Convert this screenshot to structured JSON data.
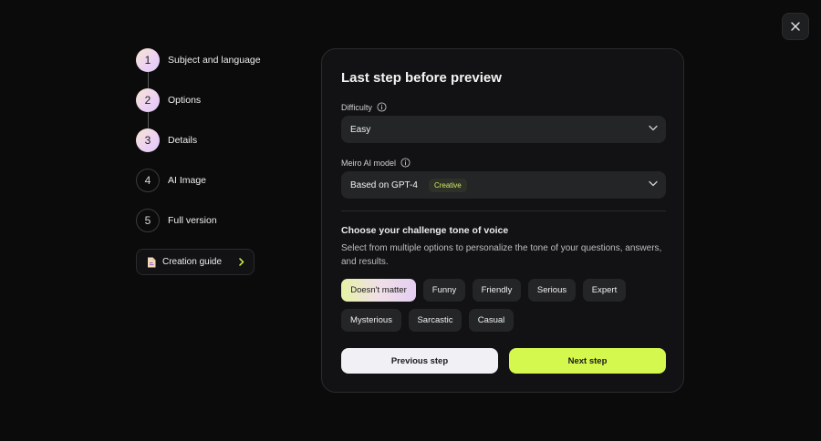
{
  "colors": {
    "background": "#0b0b0b",
    "card": "#121214",
    "accent": "#d5f84f",
    "field": "#242527"
  },
  "close_icon": "close-icon",
  "stepper": {
    "steps": [
      {
        "number": "1",
        "label": "Subject and language",
        "state": "done"
      },
      {
        "number": "2",
        "label": "Options",
        "state": "done"
      },
      {
        "number": "3",
        "label": "Details",
        "state": "done"
      },
      {
        "number": "4",
        "label": "AI Image",
        "state": "todo"
      },
      {
        "number": "5",
        "label": "Full version",
        "state": "todo"
      }
    ],
    "guide_label": "Creation guide",
    "guide_icon": "document-icon"
  },
  "card": {
    "title": "Last step before preview",
    "difficulty": {
      "label": "Difficulty",
      "value": "Easy"
    },
    "model": {
      "label": "Meiro AI model",
      "value": "Based on GPT-4",
      "badge": "Creative"
    },
    "tone": {
      "title": "Choose your challenge tone of voice",
      "description": "Select from multiple options to personalize the tone of your questions, answers, and results.",
      "options": [
        "Doesn't matter",
        "Funny",
        "Friendly",
        "Serious",
        "Expert",
        "Mysterious",
        "Sarcastic",
        "Casual"
      ],
      "selected": "Doesn't matter"
    },
    "prev_label": "Previous step",
    "next_label": "Next step"
  }
}
